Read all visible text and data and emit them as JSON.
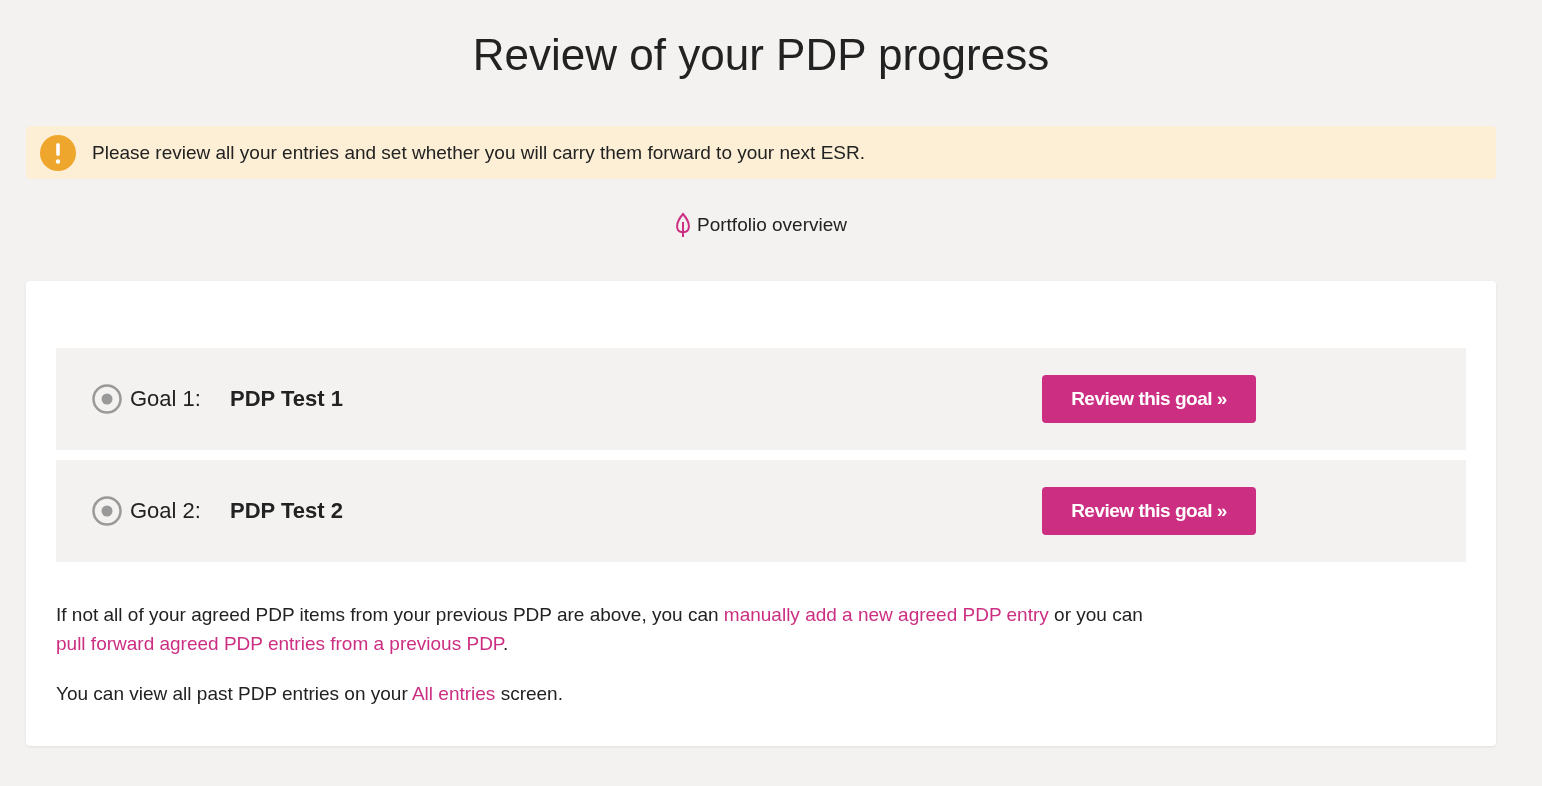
{
  "title": "Review of your PDP progress",
  "alert": {
    "text": "Please review all your entries and set whether you will carry them forward to your next ESR."
  },
  "overview_link": {
    "label": "Portfolio overview"
  },
  "goals": [
    {
      "label": "Goal 1:",
      "name": "PDP Test 1",
      "button": "Review this goal »"
    },
    {
      "label": "Goal 2:",
      "name": "PDP Test 2",
      "button": "Review this goal »"
    }
  ],
  "paragraphs": [
    [
      {
        "kind": "text",
        "text": "If not all of your agreed PDP items from your previous PDP are above, you can "
      },
      {
        "kind": "link",
        "text": "manually add a new agreed PDP entry"
      },
      {
        "kind": "text",
        "text": " or you can "
      },
      {
        "kind": "link",
        "text": "pull forward agreed PDP entries from a previous PDP"
      },
      {
        "kind": "text",
        "text": "."
      }
    ],
    [
      {
        "kind": "text",
        "text": "You can view all past PDP entries on your "
      },
      {
        "kind": "link",
        "text": "All entries"
      },
      {
        "kind": "text",
        "text": " screen."
      }
    ]
  ]
}
